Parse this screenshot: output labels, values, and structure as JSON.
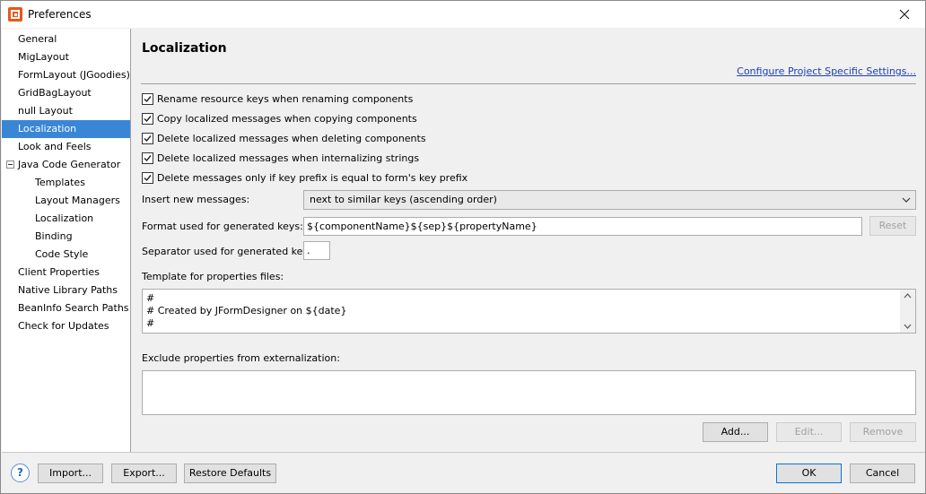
{
  "window": {
    "title": "Preferences"
  },
  "tree": {
    "items": [
      {
        "label": "General"
      },
      {
        "label": "MigLayout"
      },
      {
        "label": "FormLayout (JGoodies)"
      },
      {
        "label": "GridBagLayout"
      },
      {
        "label": "null Layout"
      },
      {
        "label": "Localization",
        "selected": true
      },
      {
        "label": "Look and Feels"
      },
      {
        "label": "Java Code Generator",
        "expanded": true
      },
      {
        "label": "Templates"
      },
      {
        "label": "Layout Managers"
      },
      {
        "label": "Localization"
      },
      {
        "label": "Binding"
      },
      {
        "label": "Code Style"
      },
      {
        "label": "Client Properties"
      },
      {
        "label": "Native Library Paths"
      },
      {
        "label": "BeanInfo Search Paths"
      },
      {
        "label": "Check for Updates"
      }
    ]
  },
  "main": {
    "title": "Localization",
    "configure_link": "Configure Project Specific Settings...",
    "checkboxes": [
      {
        "label": "Rename resource keys when renaming components",
        "checked": true
      },
      {
        "label": "Copy localized messages when copying components",
        "checked": true
      },
      {
        "label": "Delete localized messages when deleting components",
        "checked": true
      },
      {
        "label": "Delete localized messages when internalizing strings",
        "checked": true
      },
      {
        "label": "Delete messages only if key prefix is equal to form's key prefix",
        "checked": true
      }
    ],
    "insert_label": "Insert new messages:",
    "insert_value": "next to similar keys (ascending order)",
    "format_label": "Format used for generated keys:",
    "format_value": "${componentName}${sep}${propertyName}",
    "reset_label": "Reset",
    "separator_label": "Separator used for generated keys:",
    "separator_value": ".",
    "template_label": "Template for properties files:",
    "template_lines": [
      "#",
      "# Created by JFormDesigner on ${date}",
      "#"
    ],
    "exclude_label": "Exclude properties from externalization:",
    "add_label": "Add...",
    "edit_label": "Edit...",
    "remove_label": "Remove"
  },
  "footer": {
    "help_label": "?",
    "import_label": "Import...",
    "export_label": "Export...",
    "restore_label": "Restore Defaults",
    "ok_label": "OK",
    "cancel_label": "Cancel"
  }
}
